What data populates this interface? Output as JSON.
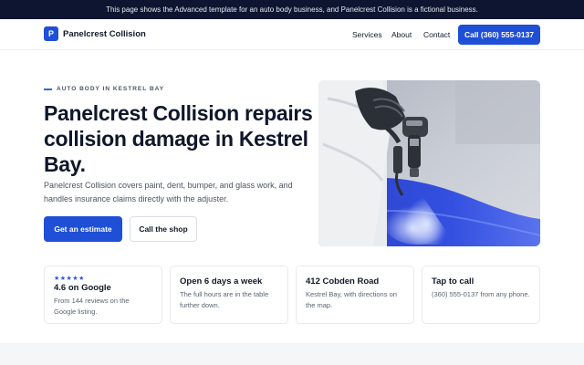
{
  "notice": "This page shows the Advanced template for an auto body business, and Panelcrest Collision is a fictional business.",
  "brand": {
    "logo_letter": "P",
    "name": "Panelcrest Collision"
  },
  "nav": {
    "links": [
      "Services",
      "About",
      "Contact"
    ],
    "cta": "Call (360) 555-0137"
  },
  "hero": {
    "eyebrow": "AUTO BODY IN KESTREL BAY",
    "headline": "Panelcrest Collision repairs collision damage in Kestrel Bay.",
    "lede": "Panelcrest Collision covers paint, dent, bumper, and glass work, and handles insurance claims directly with the adjuster.",
    "primary_button": "Get an estimate",
    "secondary_button": "Call the shop"
  },
  "cards": [
    {
      "stars": "★★★★★",
      "title": "4.6 on Google",
      "text": "From 144 reviews on the Google listing."
    },
    {
      "title": "Open 6 days a week",
      "text": "The full hours are in the table further down."
    },
    {
      "title": "412 Cobden Road",
      "text": "Kestrel Bay, with directions on the map."
    },
    {
      "title": "Tap to call",
      "text": "(360) 555-0137 from any phone."
    }
  ],
  "colors": {
    "accent": "#1e4fd6",
    "notice_bg": "#0d1530"
  }
}
